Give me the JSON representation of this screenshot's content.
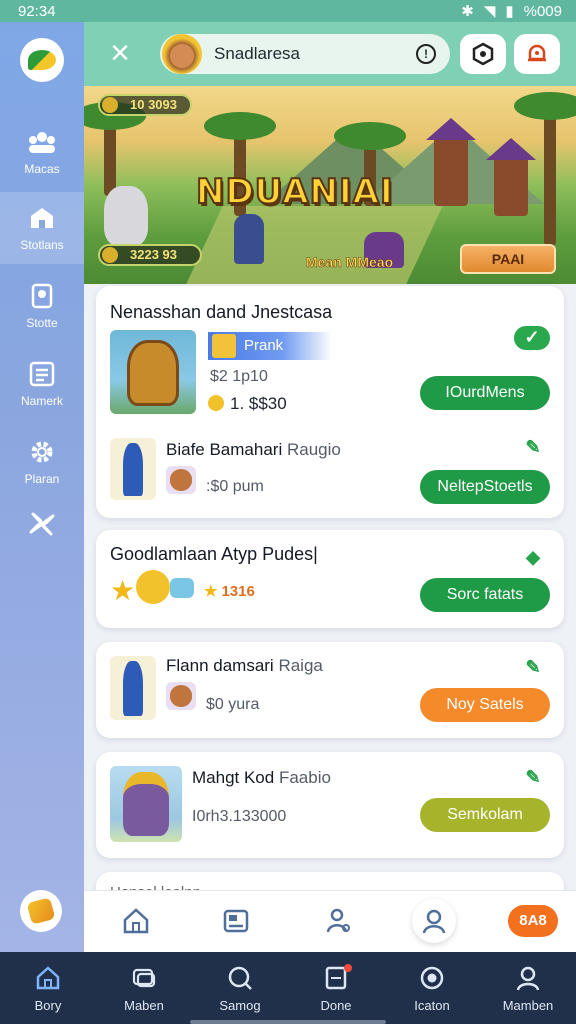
{
  "status_bar": {
    "time": "92:34",
    "battery": "%009"
  },
  "sidebar": {
    "items": [
      {
        "label": "Macas",
        "icon": "group-icon"
      },
      {
        "label": "Stotlans",
        "icon": "shop-icon",
        "active": true
      },
      {
        "label": "Stotte",
        "icon": "pin-icon"
      },
      {
        "label": "Namerk",
        "icon": "list-icon"
      },
      {
        "label": "Plaran",
        "icon": "gear-icon"
      },
      {
        "label": "",
        "icon": "pinwheel-icon"
      }
    ]
  },
  "topbar": {
    "search_text": "Snadlaresa",
    "info_symbol": "!"
  },
  "banner": {
    "title": "NDUANIAI",
    "hud_top": "10 3093",
    "hud_bottom": "3223  93",
    "caption": "Mean MMeao",
    "play_label": "PAAI"
  },
  "cards": [
    {
      "title": "Nenasshan dand Jnestcasa",
      "rows": [
        {
          "tag": "Prank",
          "meta_1": "$2 1p10",
          "meta_2": "1. $$30",
          "button": "IOurdMens"
        },
        {
          "title": "Biafe Bamahari",
          "title_sub": "Raugio",
          "meta": ":$0 pum",
          "button": "NeltepStoetls"
        }
      ]
    },
    {
      "title": "Goodlamlaan Atyp Pudes|",
      "score": "1316",
      "button": "Sorc fatats"
    },
    {
      "title": "Flann damsari",
      "title_sub": "Raiga",
      "meta": "$0 yura",
      "button": "Noy Satels"
    },
    {
      "title": "Mahgt Kod",
      "title_sub": "Faabio",
      "meta": "I0rh3.133000",
      "button": "Semkolam"
    }
  ],
  "footer_peek": "Hansel lealnn",
  "tray": {
    "badge": "8A8"
  },
  "nav": [
    {
      "label": "Bory",
      "icon": "home-icon"
    },
    {
      "label": "Maben",
      "icon": "cards-icon"
    },
    {
      "label": "Samog",
      "icon": "search-icon"
    },
    {
      "label": "Done",
      "icon": "note-icon",
      "dot": true
    },
    {
      "label": "Icaton",
      "icon": "record-icon"
    },
    {
      "label": "Mamben",
      "icon": "user-icon"
    }
  ],
  "colors": {
    "accent_green": "#1f9a46",
    "accent_orange": "#f48a2a",
    "nav_bg": "#20304a",
    "topbar": "#7fd0b4"
  }
}
